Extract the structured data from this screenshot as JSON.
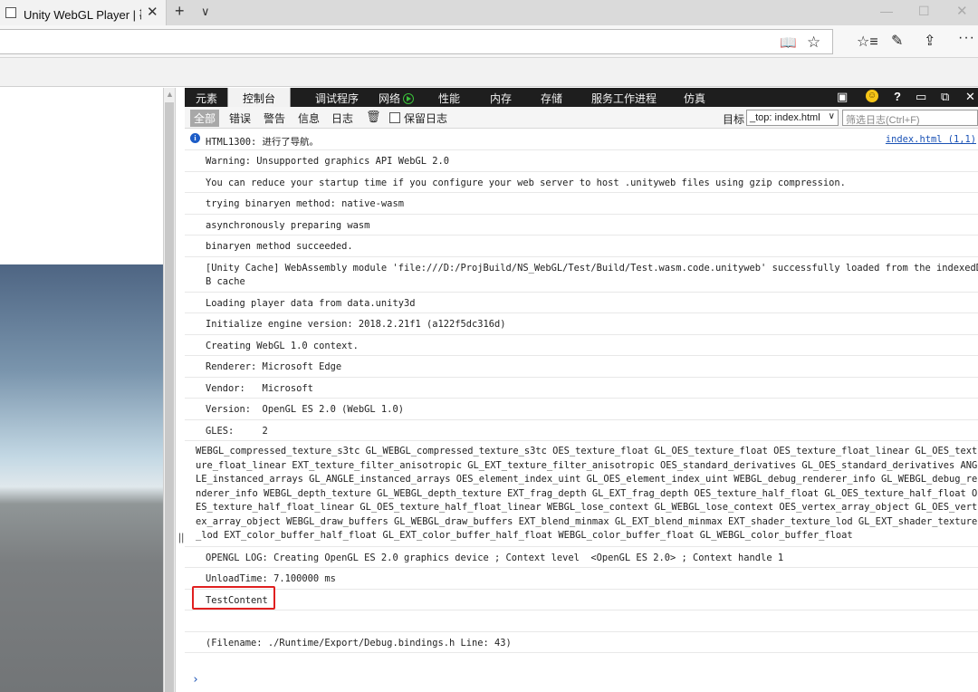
{
  "browser": {
    "tab_title": "Unity WebGL Player | 勘",
    "tab_close": "✕",
    "new_tab": "+",
    "tab_list": "∨",
    "win_min": "—",
    "win_max": "☐",
    "win_close": "✕"
  },
  "toolbar_icons": {
    "reading": "📖",
    "favorite": "☆",
    "hub": "☆≡",
    "notes": "✎",
    "share": "⇪",
    "more": "···"
  },
  "devtools": {
    "tabs": [
      "元素",
      "控制台",
      "调试程序",
      "网络",
      "性能",
      "内存",
      "存储",
      "服务工作进程",
      "仿真"
    ],
    "active_tab": "控制台",
    "right_icons": {
      "console_icon": "▣",
      "smiley": "☺",
      "help": "?",
      "dock": "▭",
      "undock": "⧉",
      "close": "✕"
    },
    "filters": [
      "全部",
      "错误",
      "警告",
      "信息",
      "日志"
    ],
    "preserve_log_label": "保留日志",
    "target_label": "目标",
    "target_value": "_top: index.html",
    "filter_placeholder": "筛选日志(Ctrl+F)",
    "splitter_grip": "||",
    "prompt": "›"
  },
  "console": {
    "first": {
      "text": "HTML1300: 进行了导航。",
      "source": "index.html (1,1)",
      "icon": "i"
    },
    "messages": [
      "Warning: Unsupported graphics API WebGL 2.0",
      "You can reduce your startup time if you configure your web server to host .unityweb files using gzip compression.",
      "trying binaryen method: native-wasm",
      "asynchronously preparing wasm",
      "binaryen method succeeded.",
      "[Unity Cache] WebAssembly module 'file:///D:/ProjBuild/NS_WebGL/Test/Build/Test.wasm.code.unityweb' successfully loaded from the indexedD\nB cache",
      "Loading player data from data.unity3d",
      "Initialize engine version: 2018.2.21f1 (a122f5dc316d)",
      "Creating WebGL 1.0 context.",
      "Renderer: Microsoft Edge",
      "Vendor:   Microsoft",
      "Version:  OpenGL ES 2.0 (WebGL 1.0)",
      "GLES:     2"
    ],
    "extensions": "WEBGL_compressed_texture_s3tc GL_WEBGL_compressed_texture_s3tc OES_texture_float GL_OES_texture_float OES_texture_float_linear GL_OES_text\nure_float_linear EXT_texture_filter_anisotropic GL_EXT_texture_filter_anisotropic OES_standard_derivatives GL_OES_standard_derivatives ANG\nLE_instanced_arrays GL_ANGLE_instanced_arrays OES_element_index_uint GL_OES_element_index_uint WEBGL_debug_renderer_info GL_WEBGL_debug_re\nnderer_info WEBGL_depth_texture GL_WEBGL_depth_texture EXT_frag_depth GL_EXT_frag_depth OES_texture_half_float GL_OES_texture_half_float O\nES_texture_half_float_linear GL_OES_texture_half_float_linear WEBGL_lose_context GL_WEBGL_lose_context OES_vertex_array_object GL_OES_vert\nex_array_object WEBGL_draw_buffers GL_WEBGL_draw_buffers EXT_blend_minmax GL_EXT_blend_minmax EXT_shader_texture_lod GL_EXT_shader_texture\n_lod EXT_color_buffer_half_float GL_EXT_color_buffer_half_float WEBGL_color_buffer_float GL_WEBGL_color_buffer_float",
    "after": [
      "OPENGL LOG: Creating OpenGL ES 2.0 graphics device ; Context level  <OpenGL ES 2.0> ; Context handle 1",
      "UnloadTime: 7.100000 ms",
      "TestContent",
      "",
      "(Filename: ./Runtime/Export/Debug.bindings.h Line: 43)"
    ]
  },
  "colors": {
    "devtools_tabbar": "#1e1e1e",
    "link": "#1a52b5",
    "highlight_box": "#e02020",
    "network_indicator": "#3ac23a"
  }
}
